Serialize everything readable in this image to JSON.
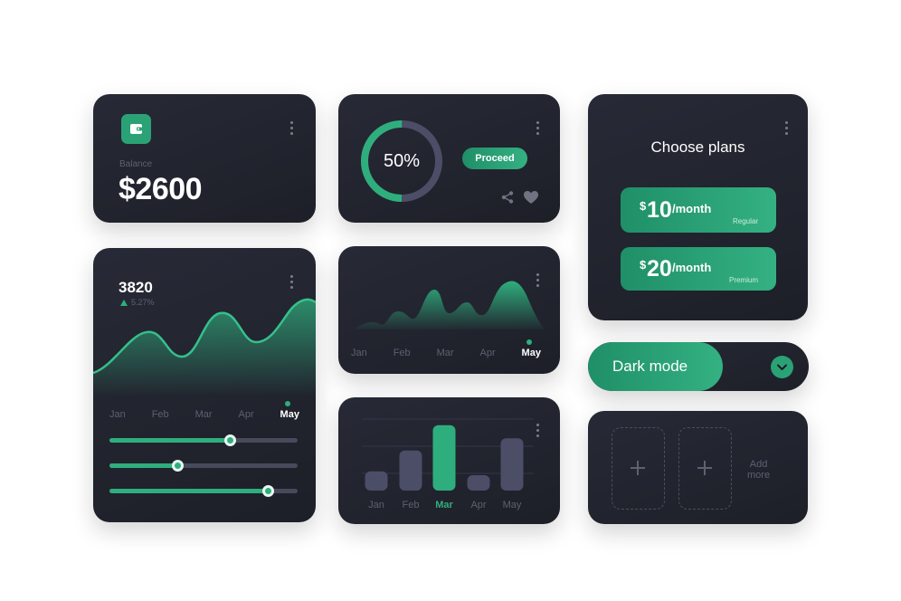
{
  "balance_card": {
    "label": "Balance",
    "amount": "$2600"
  },
  "progress_card": {
    "percent_label": "50%",
    "percent": 50,
    "proceed_label": "Proceed"
  },
  "plans_card": {
    "title": "Choose plans",
    "plans": [
      {
        "currency": "$",
        "amount": "10",
        "period": "/month",
        "tier": "Regular"
      },
      {
        "currency": "$",
        "amount": "20",
        "period": "/month",
        "tier": "Premium"
      }
    ]
  },
  "stats_card": {
    "value": "3820",
    "change": "5.27%",
    "months": [
      "Jan",
      "Feb",
      "Mar",
      "Apr",
      "May"
    ],
    "active_month": "May",
    "sliders": [
      0.64,
      0.36,
      0.84
    ]
  },
  "area_card": {
    "months": [
      "Jan",
      "Feb",
      "Mar",
      "Apr",
      "May"
    ],
    "active_month": "May"
  },
  "bar_card": {
    "chart_data": {
      "type": "bar",
      "categories": [
        "Jan",
        "Feb",
        "Mar",
        "Apr",
        "May"
      ],
      "values": [
        25,
        52,
        85,
        20,
        68
      ],
      "highlight": "Mar",
      "ylim": [
        0,
        100
      ]
    }
  },
  "dark_mode": {
    "label": "Dark mode"
  },
  "add_card": {
    "label_line1": "Add",
    "label_line2": "more"
  },
  "colors": {
    "accent": "#2fae7d",
    "card": "#21232d",
    "bar": "#4b4e66",
    "muted": "#5d6170"
  }
}
